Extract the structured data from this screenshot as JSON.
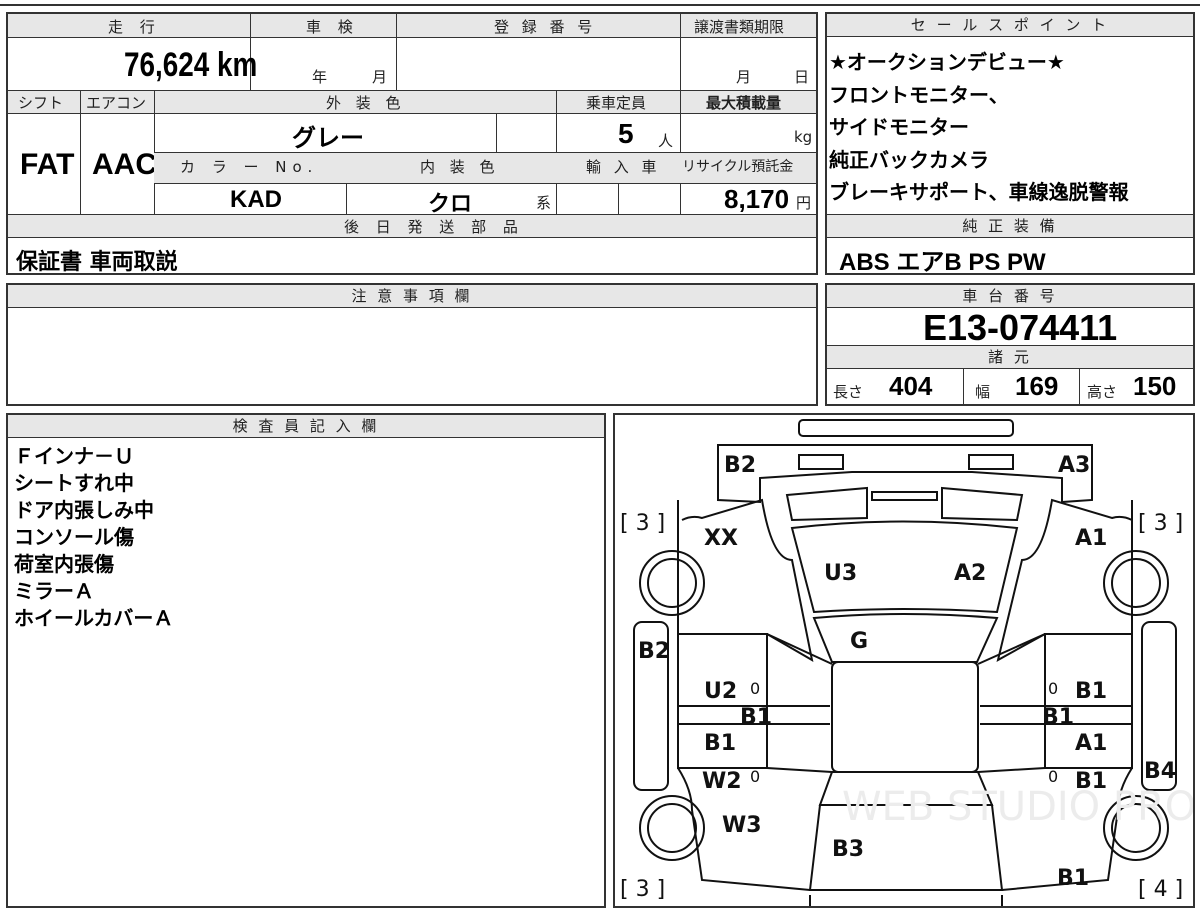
{
  "header": {
    "mileage_label": "走 行",
    "inspection_label": "車 検",
    "reg_no_label": "登 録 番 号",
    "transfer_deadline_label": "譲渡書類期限",
    "mileage_value": "76,624 km",
    "year_unit": "年",
    "month_unit": "月",
    "day_unit": "日"
  },
  "specs": {
    "shift_label": "シフト",
    "ac_label": "エアコン",
    "exterior_color_label": "外 装 色",
    "capacity_label": "乗車定員",
    "max_load_label": "最大積載量",
    "shift_value": "FAT",
    "ac_value": "AAC",
    "exterior_color_value": "グレー",
    "capacity_value": "5",
    "capacity_unit": "人",
    "load_unit": "kg",
    "color_no_label": "カ ラ ー No.",
    "interior_color_label": "内 装 色",
    "import_label": "輸 入 車",
    "recycle_label": "リサイクル預託金",
    "color_no_value": "KAD",
    "interior_color_value": "クロ",
    "interior_suffix": "系",
    "recycle_value": "8,170",
    "recycle_unit": "円",
    "later_parts_label": "後 日 発 送 部 品",
    "later_parts_value": "保証書 車両取説"
  },
  "sales_points": {
    "label": "セ ー ル ス ポ イ ン ト",
    "items": [
      "★オークションデビュー★",
      "フロントモニター、",
      "サイドモニター",
      "純正バックカメラ",
      "ブレーキサポート、車線逸脱警報"
    ]
  },
  "equipment": {
    "label": "純 正 装 備",
    "value": "ABS エアB PS PW"
  },
  "notes": {
    "label": "注 意 事 項 欄"
  },
  "chassis": {
    "label": "車 台 番 号",
    "value": "E13-074411",
    "dims_label": "諸 元",
    "length_label": "長さ",
    "length_value": "404",
    "width_label": "幅",
    "width_value": "169",
    "height_label": "高さ",
    "height_value": "150"
  },
  "inspector": {
    "label": "検 査 員 記 入 欄",
    "lines": [
      "Ｆインナ－Ｕ",
      "シートすれ中",
      "ドア内張しみ中",
      "コンソール傷",
      "荷室内張傷",
      "ミラーＡ",
      "ホイールカバーＡ"
    ]
  },
  "diagram": {
    "tire_left_front": "[ 3 ]",
    "tire_right_front": "[ 3 ]",
    "tire_left_rear": "[ 3 ]",
    "tire_right_rear": "[ 4 ]",
    "marks": {
      "front_bumper_left": "B2",
      "front_bumper_right": "A3",
      "left_fender": "XX",
      "right_fender": "A1",
      "hood_left": "U3",
      "hood_right": "A2",
      "windshield": "G",
      "left_side": "B2",
      "left_front_door": "U2",
      "left_front_door_zero": "0",
      "left_pillar": "B1",
      "left_rear_door_top": "B1",
      "left_rear_door": "W2",
      "left_rear_door_zero": "0",
      "left_quarter": "W3",
      "rear": "B3",
      "right_front_door_zero": "0",
      "right_front_door": "B1",
      "right_pillar": "B1",
      "right_rear_door_top": "A1",
      "right_rear_door_zero": "0",
      "right_rear_door": "B1",
      "right_side": "B4",
      "right_rear_quarter": "B1"
    }
  },
  "watermark": "WEB STUDIO PRO"
}
